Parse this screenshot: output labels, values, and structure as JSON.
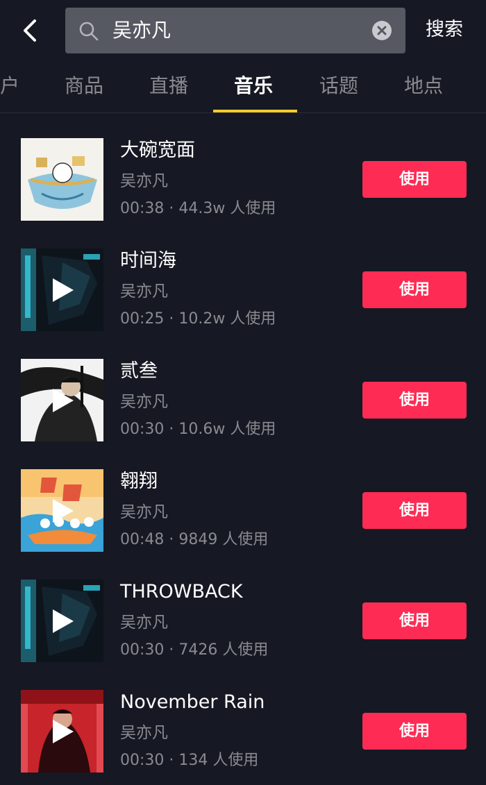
{
  "search": {
    "query": "吴亦凡",
    "action_label": "搜索"
  },
  "tabs": [
    {
      "label": "户"
    },
    {
      "label": "商品"
    },
    {
      "label": "直播"
    },
    {
      "label": "音乐",
      "active": true
    },
    {
      "label": "话题"
    },
    {
      "label": "地点"
    }
  ],
  "songs": [
    {
      "title": "大碗宽面",
      "artist": "吴亦凡",
      "duration": "00:38",
      "separator": "·",
      "uses": "44.3w 人使用",
      "button": "使用",
      "has_play": false
    },
    {
      "title": "时间海",
      "artist": "吴亦凡",
      "duration": "00:25",
      "separator": "·",
      "uses": "10.2w 人使用",
      "button": "使用",
      "has_play": true
    },
    {
      "title": "贰叁",
      "artist": "吴亦凡",
      "duration": "00:30",
      "separator": "·",
      "uses": "10.6w 人使用",
      "button": "使用",
      "has_play": true
    },
    {
      "title": "翱翔",
      "artist": "吴亦凡",
      "duration": "00:48",
      "separator": "·",
      "uses": "9849 人使用",
      "button": "使用",
      "has_play": true
    },
    {
      "title": "THROWBACK",
      "artist": "吴亦凡",
      "duration": "00:30",
      "separator": "·",
      "uses": "7426 人使用",
      "button": "使用",
      "has_play": true
    },
    {
      "title": "November Rain",
      "artist": "吴亦凡",
      "duration": "00:30",
      "separator": "·",
      "uses": "134 人使用",
      "button": "使用",
      "has_play": true
    }
  ],
  "colors": {
    "background": "#161823",
    "accent_button": "#fe2c55",
    "tab_indicator": "#facd2c",
    "secondary_text": "#8a8b91"
  },
  "icons": {
    "back": "back-arrow-icon",
    "search": "search-icon",
    "clear": "clear-icon",
    "play": "play-icon"
  }
}
